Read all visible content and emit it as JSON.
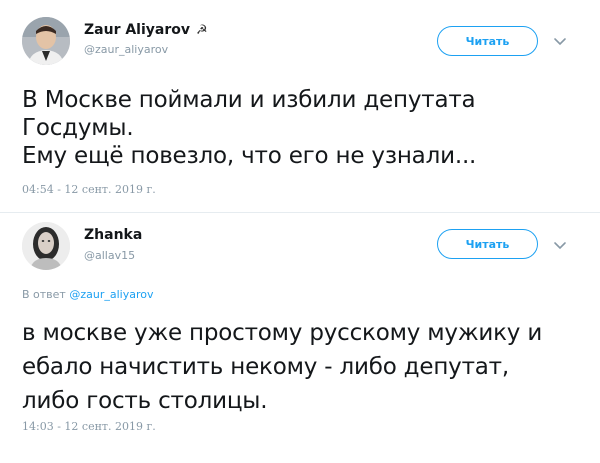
{
  "tweets": [
    {
      "author_name": "Zaur Aliyarov",
      "author_badge": "☭",
      "handle": "@zaur_aliyarov",
      "follow_label": "Читать",
      "text_lines": [
        "В Москве поймали и избили депутата",
        "Госдумы.",
        "Ему ещё повезло, что его не узнали..."
      ],
      "timestamp": "04:54 - 12 сент. 2019 г."
    },
    {
      "author_name": "Zhanka",
      "handle": "@allav15",
      "follow_label": "Читать",
      "reply_prefix": "В ответ",
      "reply_handle": "@zaur_aliyarov",
      "text_lines": [
        "в москве уже простому русскому мужику и",
        "ебало начистить некому - либо депутат,",
        "либо гость столицы."
      ],
      "timestamp": "14:03 - 12 сент. 2019 г."
    }
  ],
  "colors": {
    "accent": "#1da1f2",
    "muted": "#8899a6",
    "text": "#14171a",
    "divider": "#e6ecf0"
  },
  "icons": {
    "menu": "chevron-down-icon",
    "avatar": "user-avatar"
  }
}
